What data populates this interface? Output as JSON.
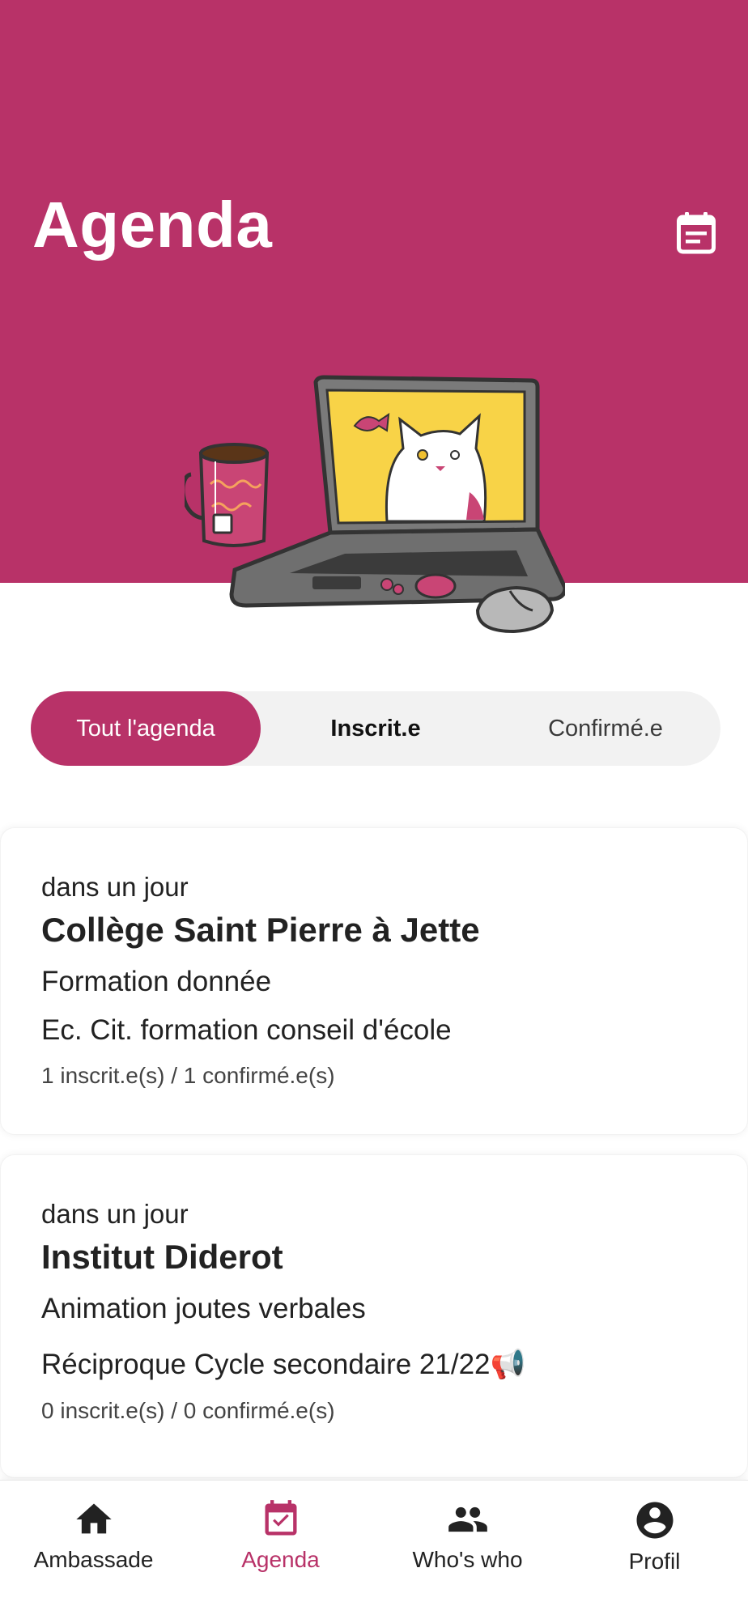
{
  "header": {
    "title": "Agenda",
    "calendar_icon": "calendar-list-icon",
    "background": "#b83268"
  },
  "illustration": {
    "name": "cat-laptop-mug-illustration"
  },
  "filters": {
    "tabs": [
      {
        "label": "Tout l'agenda",
        "active": true
      },
      {
        "label": "Inscrit.e",
        "active": false
      },
      {
        "label": "Confirmé.e",
        "active": false
      }
    ]
  },
  "events": [
    {
      "when": "dans un jour",
      "name": "Collège Saint Pierre à  Jette",
      "type": "Formation donnée",
      "subtitle": "Ec. Cit. formation conseil d'école",
      "counts": "1 inscrit.e(s) / 1 confirmé.e(s)"
    },
    {
      "when": "dans un jour",
      "name": "Institut Diderot",
      "type": "Animation joutes verbales",
      "subtitle": "Réciproque Cycle secondaire 21/22📢",
      "counts": "0 inscrit.e(s) / 0 confirmé.e(s)"
    }
  ],
  "bottom_nav": {
    "items": [
      {
        "label": "Ambassade",
        "icon": "home-icon",
        "active": false
      },
      {
        "label": "Agenda",
        "icon": "calendar-check-icon",
        "active": true
      },
      {
        "label": "Who's who",
        "icon": "people-icon",
        "active": false
      },
      {
        "label": "Profil",
        "icon": "account-circle-icon",
        "active": false
      }
    ]
  },
  "colors": {
    "accent": "#b83268",
    "tab_track": "#f2f2f2"
  }
}
